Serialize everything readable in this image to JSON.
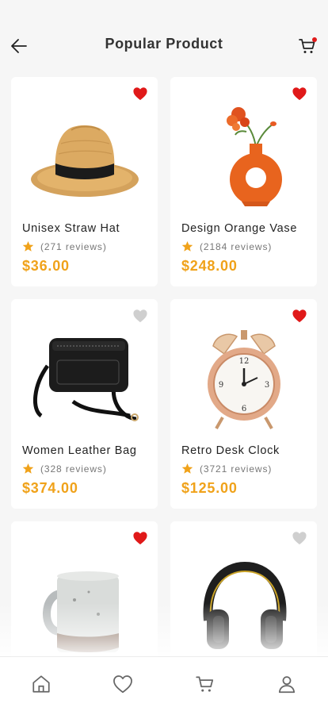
{
  "header": {
    "title": "Popular Product",
    "cart_badge_color": "#e01919"
  },
  "colors": {
    "price": "#f0a21a",
    "star": "#f0a21a",
    "favorite_active": "#e01919",
    "favorite_inactive": "#cfcfcf"
  },
  "products": [
    {
      "name": "Unisex Straw Hat",
      "reviews": "(271 reviews)",
      "price": "$36.00",
      "favorite": true,
      "image": "straw-hat"
    },
    {
      "name": "Design Orange Vase",
      "reviews": "(2184 reviews)",
      "price": "$248.00",
      "favorite": true,
      "image": "orange-vase"
    },
    {
      "name": "Women Leather Bag",
      "reviews": "(328 reviews)",
      "price": "$374.00",
      "favorite": false,
      "image": "leather-bag"
    },
    {
      "name": "Retro Desk Clock",
      "reviews": "(3721 reviews)",
      "price": "$125.00",
      "favorite": true,
      "image": "alarm-clock"
    },
    {
      "name": "",
      "reviews": "",
      "price": "",
      "favorite": true,
      "image": "ceramic-mug"
    },
    {
      "name": "",
      "reviews": "",
      "price": "",
      "favorite": false,
      "image": "headphones"
    }
  ],
  "bottom_nav": [
    {
      "icon": "home-icon"
    },
    {
      "icon": "heart-icon"
    },
    {
      "icon": "cart-icon"
    },
    {
      "icon": "profile-icon"
    }
  ]
}
